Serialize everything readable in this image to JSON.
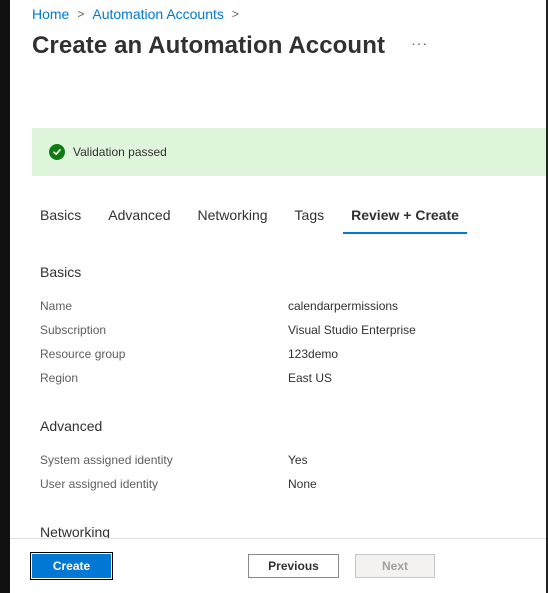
{
  "breadcrumb": {
    "home": "Home",
    "parent": "Automation Accounts"
  },
  "page": {
    "title": "Create an Automation Account",
    "more": "···"
  },
  "validation": {
    "text": "Validation passed",
    "color": "#107c10"
  },
  "tabs": [
    {
      "label": "Basics"
    },
    {
      "label": "Advanced"
    },
    {
      "label": "Networking"
    },
    {
      "label": "Tags"
    },
    {
      "label": "Review + Create",
      "active": true
    }
  ],
  "basics": {
    "title": "Basics",
    "rows": [
      {
        "label": "Name",
        "value": "calendarpermissions"
      },
      {
        "label": "Subscription",
        "value": "Visual Studio Enterprise"
      },
      {
        "label": "Resource group",
        "value": "123demo"
      },
      {
        "label": "Region",
        "value": "East US"
      }
    ]
  },
  "advanced": {
    "title": "Advanced",
    "rows": [
      {
        "label": "System assigned identity",
        "value": "Yes"
      },
      {
        "label": "User assigned identity",
        "value": "None"
      }
    ]
  },
  "networking": {
    "title": "Networking"
  },
  "footer": {
    "create": "Create",
    "previous": "Previous",
    "next": "Next"
  },
  "colors": {
    "accent": "#0078d4",
    "success_bg": "#dff6dd"
  }
}
